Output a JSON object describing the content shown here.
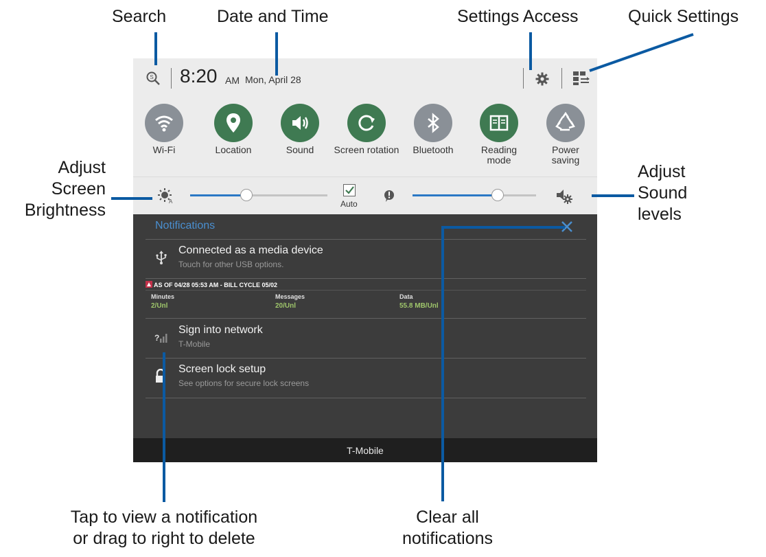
{
  "callouts": {
    "search": "Search",
    "date_time": "Date and Time",
    "settings_access": "Settings Access",
    "quick_settings": "Quick Settings",
    "adjust_brightness": [
      "Adjust",
      "Screen",
      "Brightness"
    ],
    "adjust_sound": [
      "Adjust",
      "Sound",
      "levels"
    ],
    "tap_view": [
      "Tap to view a notification",
      "or drag to right to delete"
    ],
    "clear_all": [
      "Clear all",
      "notifications"
    ]
  },
  "status_bar": {
    "time": "8:20",
    "ampm": "AM",
    "date": "Mon, April 28",
    "icons": [
      "search-icon",
      "settings-gear-icon",
      "quick-settings-grid-icon"
    ]
  },
  "quick_settings": [
    {
      "label": "Wi-Fi",
      "state": "off",
      "icon": "wifi-icon"
    },
    {
      "label": "Location",
      "state": "on",
      "icon": "location-pin-icon"
    },
    {
      "label": "Sound",
      "state": "on",
      "icon": "speaker-icon"
    },
    {
      "label": "Screen rotation",
      "state": "on",
      "icon": "rotate-icon"
    },
    {
      "label": "Bluetooth",
      "state": "off",
      "icon": "bluetooth-icon"
    },
    {
      "label": "Reading mode",
      "state": "on",
      "icon": "book-icon"
    },
    {
      "label": "Power saving",
      "state": "off",
      "icon": "recycle-icon"
    }
  ],
  "brightness": {
    "level": 0.41,
    "auto_label": "Auto",
    "auto_checked": true
  },
  "volume": {
    "level": 0.69
  },
  "notifications": {
    "title": "Notifications",
    "items": [
      {
        "title": "Connected as a media device",
        "subtitle": "Touch for other USB options.",
        "icon": "usb-icon"
      },
      {
        "title": "Sign into network",
        "subtitle": "T-Mobile",
        "icon": "signal-unknown-icon"
      },
      {
        "title": "Screen lock setup",
        "subtitle": "See options for secure lock screens",
        "icon": "lock-icon"
      }
    ],
    "usage": {
      "header": "AS OF  04/28 05:53 AM - BILL CYCLE 05/02",
      "minutes_label": "Minutes",
      "minutes_value": "2/Unl",
      "messages_label": "Messages",
      "messages_value": "20/Unl",
      "data_label": "Data",
      "data_value": "55.8 MB/Unl"
    }
  },
  "carrier": "T-Mobile",
  "colors": {
    "accent": "#2a78c5",
    "callout_line": "#0b5aa2",
    "toggle_on": "#3f7a52",
    "toggle_off": "#8a9097"
  }
}
